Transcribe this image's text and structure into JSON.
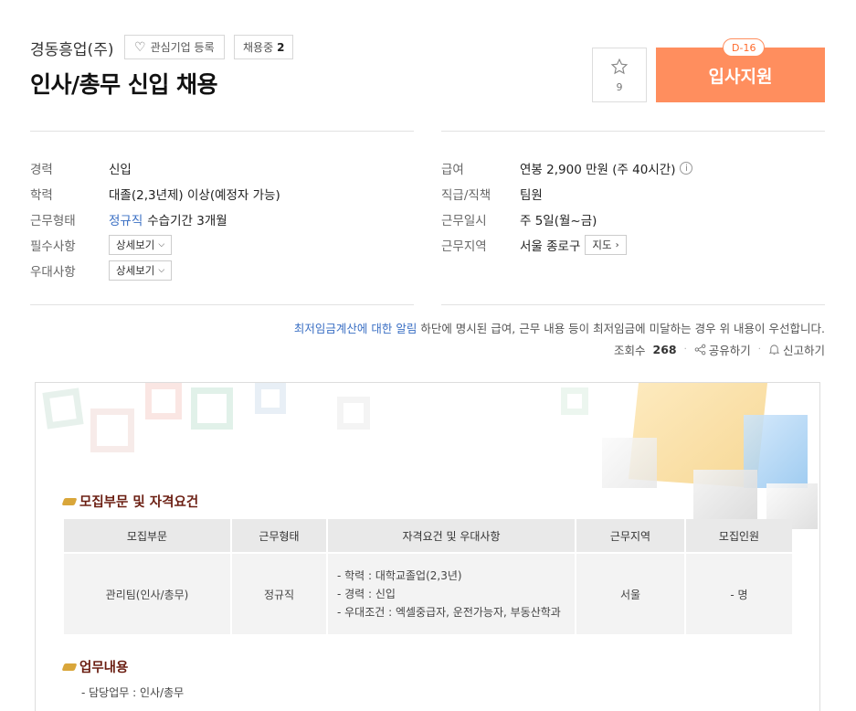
{
  "header": {
    "company": "경동흥업(주)",
    "interest_label": "관심기업 등록",
    "hiring_label": "채용중",
    "hiring_count": "2",
    "title": "인사/총무 신입 채용",
    "scrap_count": "9",
    "apply_label": "입사지원",
    "dday": "D-16",
    "apply_color": "#ff8e5e"
  },
  "left_info": [
    {
      "label": "경력",
      "value": "신입"
    },
    {
      "label": "학력",
      "value": "대졸(2,3년제) 이상(예정자 가능)"
    },
    {
      "label": "근무형태",
      "value_link": "정규직",
      "value_extra": "수습기간 3개월"
    },
    {
      "label": "필수사항",
      "button": "상세보기"
    },
    {
      "label": "우대사항",
      "button": "상세보기"
    }
  ],
  "right_info": [
    {
      "label": "급여",
      "value": "연봉 2,900 만원 (주 40시간)",
      "icon": "i"
    },
    {
      "label": "직급/직책",
      "value": "팀원"
    },
    {
      "label": "근무일시",
      "value": "주 5일(월~금)"
    },
    {
      "label": "근무지역",
      "value": "서울 종로구",
      "button": "지도"
    }
  ],
  "notice": {
    "link": "최저임금계산에 대한 알림",
    "text": " 하단에 명시된 급여, 근무 내용 등이 최저임금에 미달하는 경우 위 내용이 우선합니다."
  },
  "meta": {
    "views_label": "조회수",
    "views": "268",
    "share_label": "공유하기",
    "report_label": "신고하기"
  },
  "detail": {
    "section1_title": "모집부문 및 자격요건",
    "columns": [
      "모집부문",
      "근무형태",
      "자격요건 및 우대사항",
      "근무지역",
      "모집인원"
    ],
    "row": {
      "dept": "관리팀(인사/총무)",
      "type": "정규직",
      "req": [
        "- 학력 : 대학교졸업(2,3년)",
        "- 경력 : 신입",
        "- 우대조건 : 엑셀중급자, 운전가능자, 부동산학과"
      ],
      "region": "서울",
      "count": "- 명"
    },
    "section2_title": "업무내용",
    "duty": "- 담당업무 :  인사/총무"
  }
}
